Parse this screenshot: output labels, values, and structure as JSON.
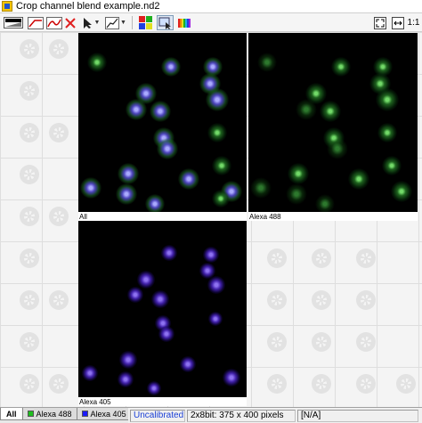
{
  "window": {
    "title": "Crop channel blend example.nd2"
  },
  "toolbar": {
    "icons": [
      "view-icon",
      "zoom-icon",
      "curve-icon",
      "cancel-crop-icon",
      "pointer-icon",
      "lut-icon",
      "channels-grid-icon",
      "roi-select-icon",
      "color-bars-icon",
      "fit-to-screen-icon",
      "fit-width-icon",
      "zoom-1to1-icon"
    ],
    "zoom_1to1_label": "1:1"
  },
  "panels": [
    {
      "label": "All",
      "channel": "merged"
    },
    {
      "label": "Alexa 488",
      "channel": "green"
    },
    {
      "label": "Alexa 405",
      "channel": "blue"
    }
  ],
  "tabs": [
    {
      "label": "All",
      "active": true
    },
    {
      "label": "Alexa 488",
      "color": "#1fbf1f"
    },
    {
      "label": "Alexa 405",
      "color": "#1a1aff"
    }
  ],
  "status": {
    "calibration": "Uncalibrated",
    "image_info": "2x8bit: 375 x 400 pixels",
    "extra": "[N/A]"
  },
  "colors": {
    "calibration_text": "#1a3fd6",
    "background": "#f4f4f4"
  }
}
